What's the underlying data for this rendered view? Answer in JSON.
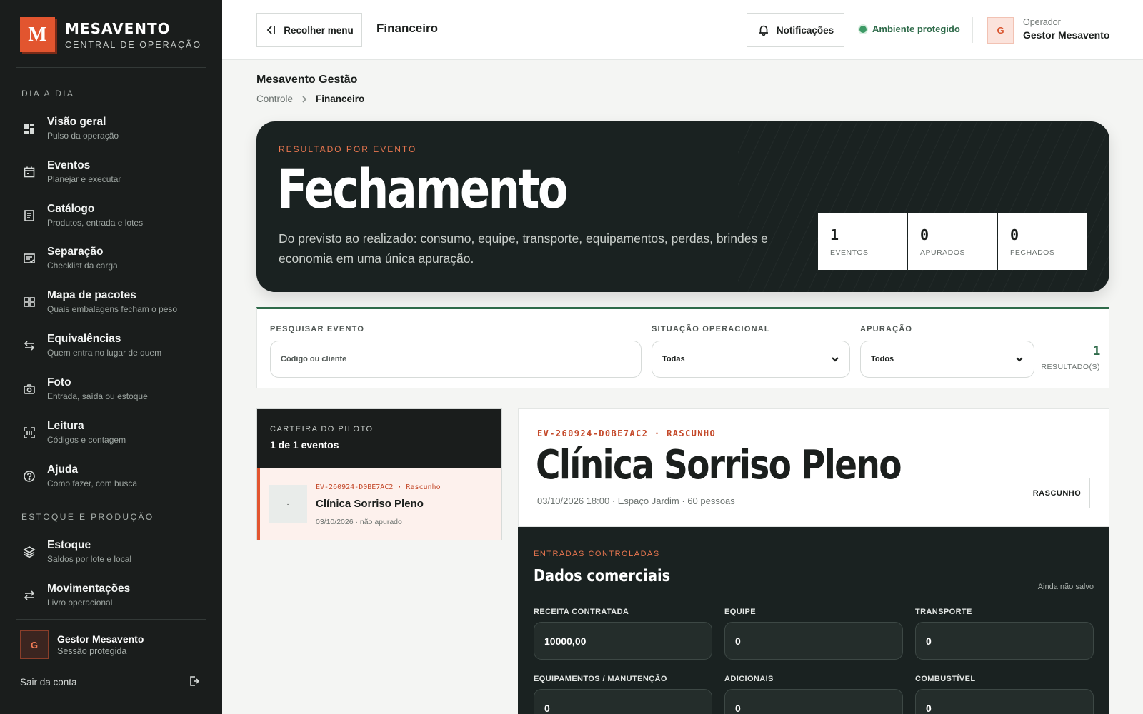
{
  "brand": {
    "logo_letter": "M",
    "name": "MESAVENTO",
    "subtitle": "CENTRAL DE OPERAÇÃO"
  },
  "sidebar": {
    "sections": [
      {
        "label": "DIA A DIA"
      },
      {
        "label": "ESTOQUE E PRODUÇÃO"
      }
    ],
    "items": [
      {
        "title": "Visão geral",
        "subtitle": "Pulso da operação",
        "icon": "dashboard-icon"
      },
      {
        "title": "Eventos",
        "subtitle": "Planejar e executar",
        "icon": "calendar-icon"
      },
      {
        "title": "Catálogo",
        "subtitle": "Produtos, entrada e lotes",
        "icon": "document-icon"
      },
      {
        "title": "Separação",
        "subtitle": "Checklist da carga",
        "icon": "checklist-icon"
      },
      {
        "title": "Mapa de pacotes",
        "subtitle": "Quais embalagens fecham o peso",
        "icon": "grid-icon"
      },
      {
        "title": "Equivalências",
        "subtitle": "Quem entra no lugar de quem",
        "icon": "swap-icon"
      },
      {
        "title": "Foto",
        "subtitle": "Entrada, saída ou estoque",
        "icon": "camera-icon"
      },
      {
        "title": "Leitura",
        "subtitle": "Códigos e contagem",
        "icon": "scan-icon"
      },
      {
        "title": "Ajuda",
        "subtitle": "Como fazer, com busca",
        "icon": "help-icon"
      },
      {
        "title": "Estoque",
        "subtitle": "Saldos por lote e local",
        "icon": "layers-icon"
      },
      {
        "title": "Movimentações",
        "subtitle": "Livro operacional",
        "icon": "arrows-icon"
      }
    ],
    "user": {
      "initial": "G",
      "name": "Gestor Mesavento",
      "subtitle": "Sessão protegida"
    },
    "logout_label": "Sair da conta"
  },
  "topbar": {
    "collapse_label": "Recolher menu",
    "title": "Financeiro",
    "notifications_label": "Notificações",
    "environment_label": "Ambiente protegido",
    "operator": {
      "initial": "G",
      "label": "Operador",
      "name": "Gestor Mesavento"
    }
  },
  "page": {
    "org": "Mesavento Gestão",
    "breadcrumb": [
      "Controle",
      "Financeiro"
    ]
  },
  "hero": {
    "eyebrow": "RESULTADO POR EVENTO",
    "title": "Fechamento",
    "description": "Do previsto ao realizado: consumo, equipe, transporte, equipamentos, perdas, brindes e economia em uma única apuração.",
    "kpis": [
      {
        "value": "1",
        "label": "EVENTOS"
      },
      {
        "value": "0",
        "label": "APURADOS"
      },
      {
        "value": "0",
        "label": "FECHADOS"
      }
    ]
  },
  "filters": {
    "search": {
      "label": "PESQUISAR EVENTO",
      "placeholder": "Código ou cliente"
    },
    "status": {
      "label": "SITUAÇÃO OPERACIONAL",
      "value": "Todas"
    },
    "apuracao": {
      "label": "APURAÇÃO",
      "value": "Todos"
    },
    "results": {
      "count": "1",
      "label": "RESULTADO(S)"
    }
  },
  "portfolio": {
    "eyebrow": "CARTEIRA DO PILOTO",
    "count_text": "1 de 1 eventos",
    "items": [
      {
        "thumb": "·",
        "code": "EV-260924-D0BE7AC2 · Rascunho",
        "name": "Clínica Sorriso Pleno",
        "meta": "03/10/2026 · não apurado"
      }
    ]
  },
  "detail": {
    "code": "EV-260924-D0BE7AC2 · RASCUNHO",
    "title": "Clínica Sorriso Pleno",
    "meta": "03/10/2026 18:00 · Espaço Jardim · 60 pessoas",
    "badge": "RASCUNHO"
  },
  "form": {
    "eyebrow": "ENTRADAS CONTROLADAS",
    "title": "Dados comerciais",
    "status": "Ainda não salvo",
    "fields": [
      {
        "label": "RECEITA CONTRATADA",
        "value": "10000,00"
      },
      {
        "label": "EQUIPE",
        "value": "0"
      },
      {
        "label": "TRANSPORTE",
        "value": "0"
      },
      {
        "label": "EQUIPAMENTOS / MANUTENÇÃO",
        "value": "0"
      },
      {
        "label": "ADICIONAIS",
        "value": "0"
      },
      {
        "label": "COMBUSTÍVEL",
        "value": "0"
      }
    ]
  },
  "colors": {
    "accent": "#e2552f",
    "success": "#2f6b4a",
    "dark": "#1a2221",
    "sidebar": "#1a1d1c"
  }
}
